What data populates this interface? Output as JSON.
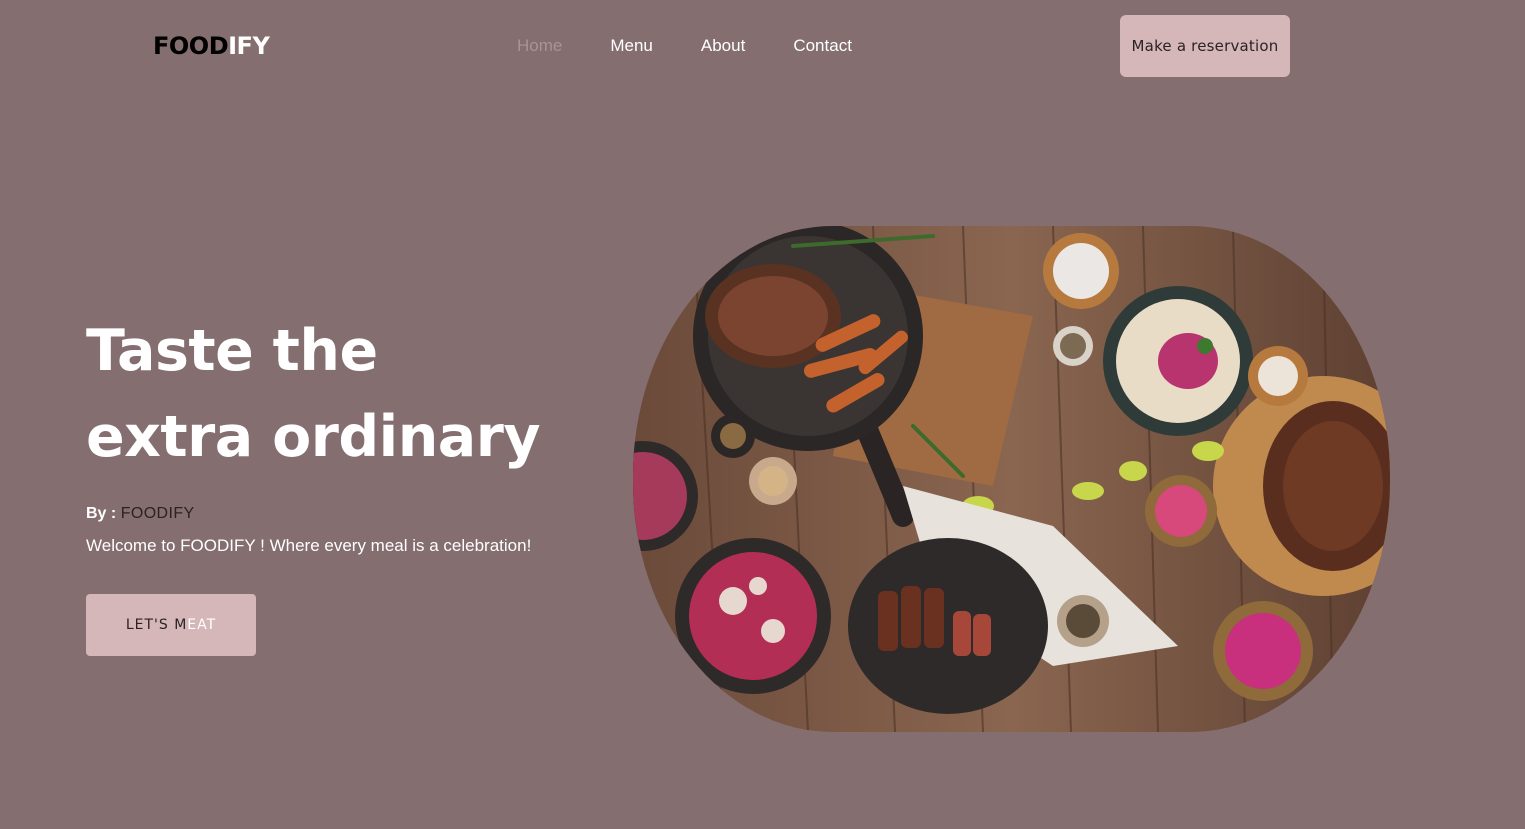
{
  "header": {
    "logo_part1": "FOOD",
    "logo_part2": "IFY",
    "nav": [
      {
        "label": "Home",
        "active": true
      },
      {
        "label": "Menu",
        "active": false
      },
      {
        "label": "About",
        "active": false
      },
      {
        "label": "Contact",
        "active": false
      }
    ],
    "reserve_label": "Make a reservation"
  },
  "hero": {
    "title_line1": "Taste the",
    "title_line2": "extra ordinary",
    "by_label": "By :",
    "author": "FOODIFY",
    "welcome": "Welcome to FOODIFY ! Where every meal is a celebration!",
    "cta_part1": "LET'S M",
    "cta_part2": "EAT",
    "image_icon": "food-spread-photo"
  },
  "colors": {
    "background": "#846e6f",
    "accent": "#d5b7b9",
    "active_nav": "#a79496",
    "dark_text": "#2b2224"
  }
}
